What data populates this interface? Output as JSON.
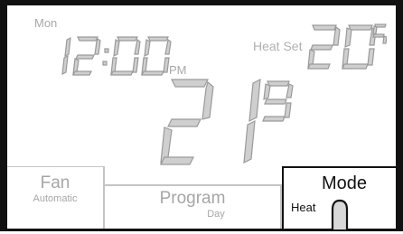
{
  "display": {
    "day": "Mon",
    "time": "12:00",
    "ampm": "PM",
    "set_label": "Heat Set",
    "set_temp": "20",
    "set_decimal": "5",
    "room_temp": "21",
    "room_decimal": "9"
  },
  "tabs": {
    "fan": {
      "label": "Fan",
      "value": "Automatic"
    },
    "program": {
      "label": "Program",
      "value": "Day"
    },
    "mode": {
      "label": "Mode",
      "value": "Heat"
    }
  },
  "colors": {
    "segment_fill": "#cfcfcf",
    "segment_stroke": "#9a9a9a",
    "active_border": "#111111",
    "inactive_border": "#c4c4c4"
  }
}
